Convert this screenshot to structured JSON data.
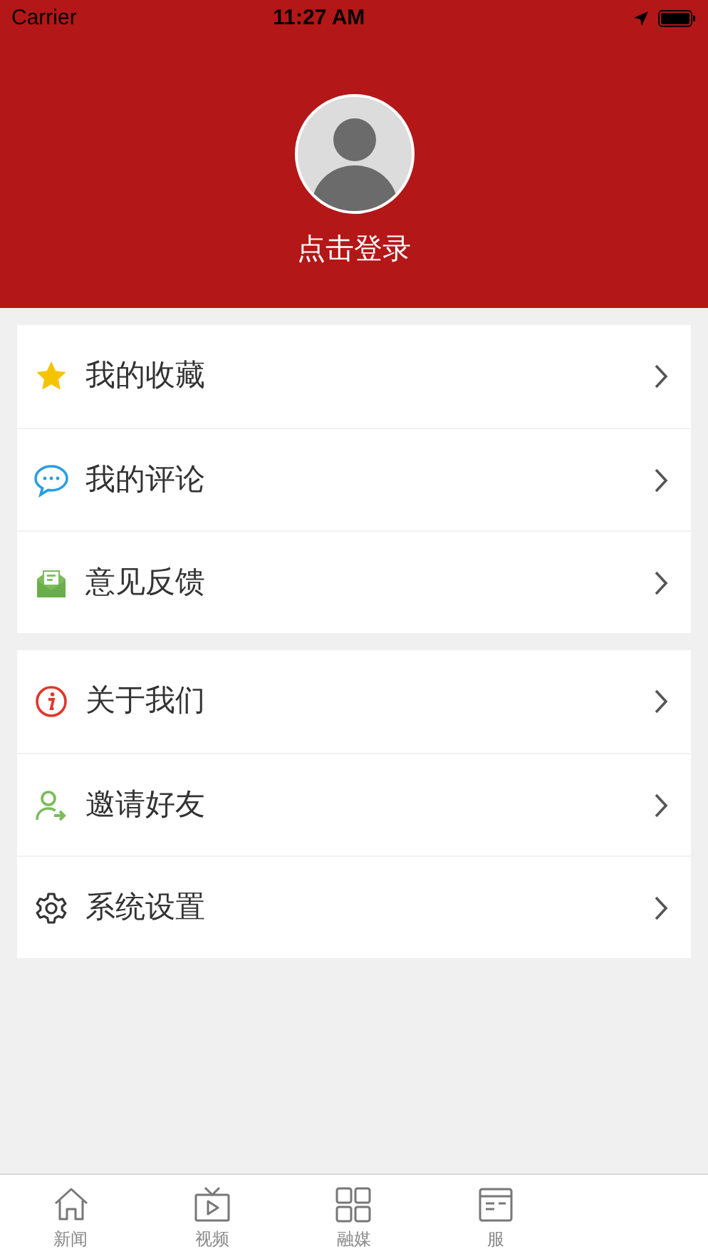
{
  "status_bar": {
    "carrier": "Carrier",
    "time": "11:27 AM"
  },
  "profile": {
    "login_label": "点击登录"
  },
  "menu_groups": [
    {
      "items": [
        {
          "kind": "star",
          "label": "我的收藏"
        },
        {
          "kind": "comment",
          "label": "我的评论"
        },
        {
          "kind": "feedback",
          "label": "意见反馈"
        }
      ]
    },
    {
      "items": [
        {
          "kind": "info",
          "label": "关于我们"
        },
        {
          "kind": "invite",
          "label": "邀请好友"
        },
        {
          "kind": "settings",
          "label": "系统设置"
        }
      ]
    }
  ],
  "tab_bar": [
    {
      "kind": "home",
      "label": "新闻"
    },
    {
      "kind": "tv",
      "label": "视频"
    },
    {
      "kind": "grid",
      "label": "融媒"
    },
    {
      "kind": "doc",
      "label": "服"
    }
  ]
}
